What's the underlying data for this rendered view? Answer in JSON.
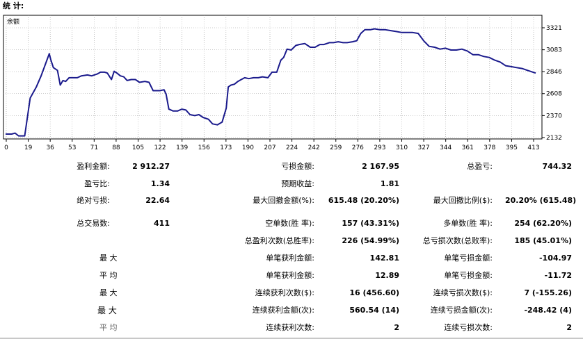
{
  "title": "统 计:",
  "chart_data": {
    "type": "line",
    "series_label": "余额",
    "line_color": "#1a1a8c",
    "grid": true,
    "x_ticks": [
      "0",
      "19",
      "36",
      "53",
      "71",
      "88",
      "105",
      "122",
      "139",
      "156",
      "173",
      "190",
      "207",
      "224",
      "242",
      "259",
      "276",
      "293",
      "310",
      "327",
      "344",
      "361",
      "378",
      "395",
      "413"
    ],
    "y_ticks": [
      "3321",
      "3083",
      "2846",
      "2608",
      "2370",
      "2132"
    ],
    "xlim": [
      0,
      419
    ],
    "ylim": [
      2132,
      3321
    ],
    "points": [
      [
        0,
        2170
      ],
      [
        9,
        2170
      ],
      [
        14,
        2180
      ],
      [
        19,
        2150
      ],
      [
        28,
        2150
      ],
      [
        36,
        2560
      ],
      [
        45,
        2680
      ],
      [
        52,
        2800
      ],
      [
        60,
        2960
      ],
      [
        64,
        3040
      ],
      [
        66,
        2980
      ],
      [
        70,
        2890
      ],
      [
        76,
        2860
      ],
      [
        80,
        2700
      ],
      [
        84,
        2750
      ],
      [
        88,
        2740
      ],
      [
        93,
        2780
      ],
      [
        98,
        2780
      ],
      [
        105,
        2780
      ],
      [
        111,
        2800
      ],
      [
        120,
        2810
      ],
      [
        126,
        2800
      ],
      [
        134,
        2820
      ],
      [
        139,
        2840
      ],
      [
        145,
        2840
      ],
      [
        149,
        2830
      ],
      [
        155,
        2760
      ],
      [
        159,
        2850
      ],
      [
        163,
        2830
      ],
      [
        168,
        2800
      ],
      [
        173,
        2790
      ],
      [
        178,
        2750
      ],
      [
        184,
        2760
      ],
      [
        190,
        2760
      ],
      [
        196,
        2730
      ],
      [
        204,
        2740
      ],
      [
        210,
        2730
      ],
      [
        216,
        2640
      ],
      [
        221,
        2640
      ],
      [
        226,
        2640
      ],
      [
        232,
        2650
      ],
      [
        235,
        2600
      ],
      [
        239,
        2440
      ],
      [
        245,
        2420
      ],
      [
        252,
        2420
      ],
      [
        258,
        2440
      ],
      [
        264,
        2430
      ],
      [
        270,
        2380
      ],
      [
        277,
        2370
      ],
      [
        283,
        2380
      ],
      [
        289,
        2350
      ],
      [
        297,
        2330
      ],
      [
        303,
        2280
      ],
      [
        310,
        2270
      ],
      [
        317,
        2300
      ],
      [
        323,
        2450
      ],
      [
        326,
        2680
      ],
      [
        330,
        2700
      ],
      [
        335,
        2710
      ],
      [
        340,
        2740
      ],
      [
        345,
        2760
      ],
      [
        350,
        2780
      ],
      [
        356,
        2770
      ],
      [
        363,
        2780
      ],
      [
        370,
        2780
      ],
      [
        376,
        2790
      ],
      [
        384,
        2780
      ],
      [
        390,
        2840
      ],
      [
        397,
        2840
      ],
      [
        403,
        2970
      ],
      [
        407,
        3000
      ],
      [
        412,
        3090
      ],
      [
        418,
        3080
      ],
      [
        425,
        3130
      ],
      [
        430,
        3140
      ],
      [
        438,
        3150
      ],
      [
        446,
        3110
      ],
      [
        453,
        3110
      ],
      [
        460,
        3140
      ],
      [
        466,
        3140
      ],
      [
        474,
        3160
      ],
      [
        480,
        3160
      ],
      [
        487,
        3170
      ],
      [
        494,
        3160
      ],
      [
        500,
        3160
      ],
      [
        508,
        3170
      ],
      [
        514,
        3180
      ],
      [
        520,
        3260
      ],
      [
        526,
        3300
      ],
      [
        534,
        3300
      ],
      [
        540,
        3310
      ],
      [
        548,
        3300
      ],
      [
        556,
        3300
      ],
      [
        564,
        3290
      ],
      [
        572,
        3280
      ],
      [
        580,
        3270
      ],
      [
        588,
        3270
      ],
      [
        596,
        3270
      ],
      [
        604,
        3260
      ],
      [
        612,
        3180
      ],
      [
        620,
        3120
      ],
      [
        628,
        3110
      ],
      [
        636,
        3090
      ],
      [
        644,
        3100
      ],
      [
        652,
        3080
      ],
      [
        660,
        3080
      ],
      [
        668,
        3090
      ],
      [
        676,
        3070
      ],
      [
        684,
        3030
      ],
      [
        692,
        3030
      ],
      [
        700,
        3010
      ],
      [
        708,
        3000
      ],
      [
        716,
        2970
      ],
      [
        724,
        2950
      ],
      [
        732,
        2910
      ],
      [
        740,
        2900
      ],
      [
        748,
        2890
      ],
      [
        756,
        2880
      ],
      [
        764,
        2860
      ],
      [
        772,
        2840
      ],
      [
        776,
        2830
      ]
    ]
  },
  "stats": {
    "gross_profit_label": "盈利金额:",
    "gross_profit": "2 912.27",
    "gross_loss_label": "亏损金额:",
    "gross_loss": "2 167.95",
    "total_net_label": "总盈亏:",
    "total_net": "744.32",
    "profit_factor_label": "盈亏比:",
    "profit_factor": "1.34",
    "expected_payoff_label": "预期收益:",
    "expected_payoff": "1.81",
    "abs_drawdown_label": "绝对亏损:",
    "abs_drawdown": "22.64",
    "max_dd_label": "最大回撤金额(%):",
    "max_dd": "615.48 (20.20%)",
    "rel_dd_label": "最大回撤比例($):",
    "rel_dd": "20.20% (615.48)",
    "total_trades_label": "总交易数:",
    "total_trades": "411",
    "short_label": "空单数(胜 率):",
    "short": "157 (43.31%)",
    "long_label": "多单数(胜 率):",
    "long": "254 (62.20%)",
    "profit_trades_label": "总盈利次数(总胜率):",
    "profit_trades": "226 (54.99%)",
    "loss_trades_label": "总亏损次数(总败率):",
    "loss_trades": "185 (45.01%)",
    "max_label": "最 大",
    "largest_profit_label": "单笔获利金额:",
    "largest_profit": "142.81",
    "largest_loss_label": "单笔亏损金额:",
    "largest_loss": "-104.97",
    "avg_label": "平 均",
    "avg_profit_label": "单笔获利金额:",
    "avg_profit": "12.89",
    "avg_loss_label": "单笔亏损金额:",
    "avg_loss": "-11.72",
    "max2_label": "最 大",
    "max_consec_wins_label": "连续获利次数($):",
    "max_consec_wins": "16 (456.60)",
    "max_consec_losses_label": "连续亏损次数($):",
    "max_consec_losses": "7 (-155.26)",
    "max3_label": "最 大",
    "max_consec_profit_label": "连续获利金额(次):",
    "max_consec_profit": "560.54 (14)",
    "max_consec_loss_label": "连续亏损金额(次):",
    "max_consec_loss": "-248.42 (4)",
    "avg2_label": "平 均",
    "avg_consec_wins_label": "连续获利次数:",
    "avg_consec_wins": "2",
    "avg_consec_losses_label": "连续亏损次数:",
    "avg_consec_losses": "2"
  }
}
